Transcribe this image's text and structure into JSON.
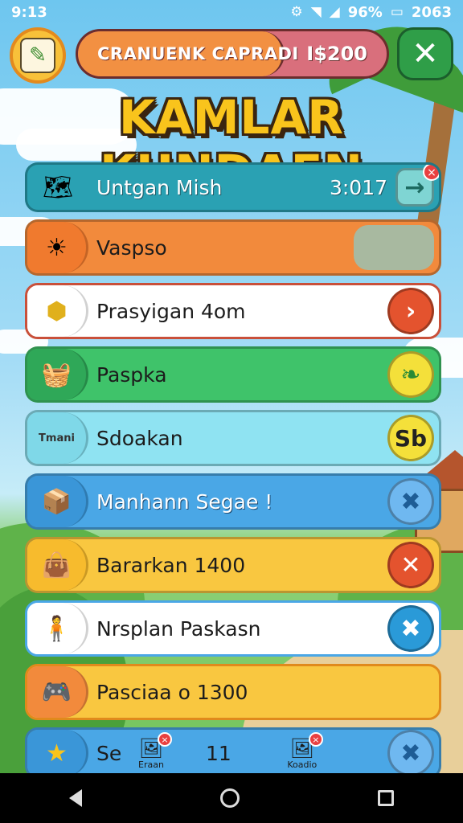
{
  "status_bar": {
    "time": "9:13",
    "battery_percent": "96%",
    "clock_right": "2063",
    "icons": [
      "settings-icon",
      "wifi-icon",
      "signal-icon",
      "battery-icon"
    ]
  },
  "header": {
    "avatar_icon": "scroll-icon",
    "bar_label": "CRANUENK CAPRADI",
    "bar_value": "I$200",
    "bar_progress": 0.67,
    "close_label": "✕"
  },
  "title": "KAMLAR KUNDAFN",
  "rows": [
    {
      "label": "Untgan Mish",
      "value": "3:017",
      "icon": "map-icon",
      "action": "→"
    },
    {
      "label": "Vaspso",
      "icon": "sun-icon"
    },
    {
      "label": "Prasyigan 4om",
      "icon": "location-pin-icon",
      "action": "›"
    },
    {
      "label": "Paspka",
      "icon": "basket-icon",
      "action": "❧"
    },
    {
      "label": "Sdoakan",
      "icon": "ticket-icon",
      "icon_text": "Tmani",
      "action": "Sb"
    },
    {
      "label": "Manhann Segae !",
      "icon": "crate-icon",
      "action": "✖"
    },
    {
      "label": "Bararkan 1400",
      "icon": "bag-icon",
      "action": "✕"
    },
    {
      "label": "Nrsplan Paskasn",
      "icon": "figure-icon",
      "action": "✖"
    },
    {
      "label": "Pasciaa o 1300",
      "icon": "gamepad-icon"
    },
    {
      "label": "Se",
      "value": "11",
      "icon": "star-icon",
      "action": "✖",
      "minis": [
        {
          "caption": "Eraan",
          "icon": "photo-icon"
        },
        {
          "caption": "Koadio",
          "icon": "frame-icon"
        }
      ]
    }
  ],
  "colors": {
    "title_fill": "#f9c41c",
    "title_outline": "#3a2510",
    "close_button": "#2f9e48"
  }
}
